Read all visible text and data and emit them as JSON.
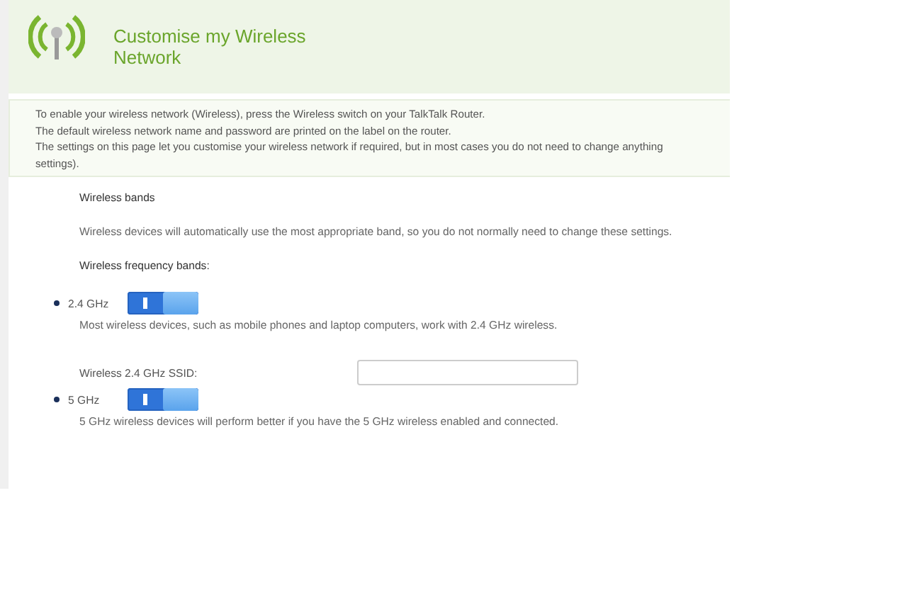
{
  "header": {
    "title": "Customise my Wireless Network"
  },
  "intro": [
    "To enable your wireless network (Wireless), press the Wireless switch on your TalkTalk Router.",
    "The default wireless network name and password are printed on the label on the router.",
    "The settings on this page let you customise your wireless network if required, but in most cases you do not need to change anything",
    "settings)."
  ],
  "section": {
    "title": "Wireless bands",
    "description": "Wireless devices will automatically use the most appropriate band, so you do not normally need to change these settings.",
    "bands_label": "Wireless frequency bands:"
  },
  "bands": [
    {
      "label": "2.4 GHz",
      "on": true,
      "description": "Most wireless devices, such as mobile phones and laptop computers, work with 2.4 GHz wireless.",
      "ssid_label": "Wireless 2.4 GHz SSID:"
    },
    {
      "label": "5 GHz",
      "on": true,
      "description": "5 GHz wireless devices will perform better if you have the 5 GHz wireless enabled and connected."
    }
  ]
}
